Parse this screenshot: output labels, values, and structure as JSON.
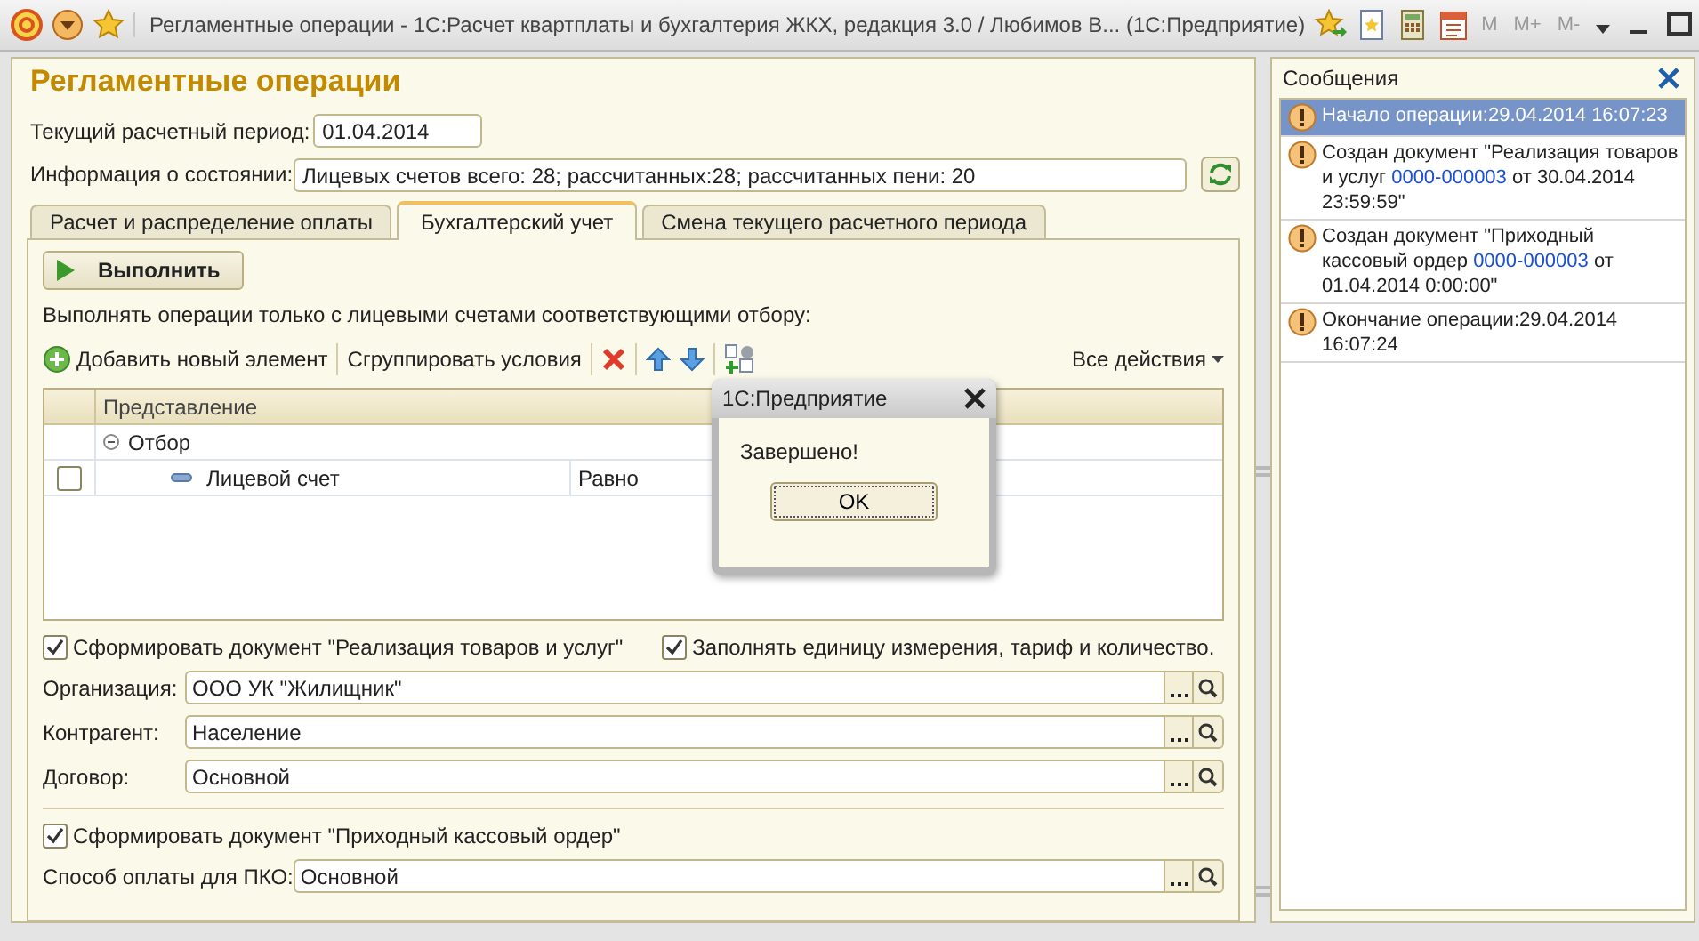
{
  "window": {
    "title": "Регламентные операции - 1С:Расчет квартплаты и бухгалтерия ЖКХ, редакция 3.0 / Любимов В...   (1С:Предприятие)",
    "memory_buttons": [
      {
        "label": "M",
        "disabled": true
      },
      {
        "label": "M+",
        "disabled": true
      },
      {
        "label": "M-",
        "disabled": true
      }
    ]
  },
  "page_title": "Регламентные операции",
  "period": {
    "label": "Текущий расчетный период:",
    "value": "01.04.2014"
  },
  "status_info": {
    "label": "Информация о состоянии:",
    "value": "Лицевых счетов всего: 28; рассчитанных:28; рассчитанных пени: 20"
  },
  "tabs": [
    {
      "label": "Расчет и распределение оплаты",
      "selected": false
    },
    {
      "label": "Бухгалтерский учет",
      "selected": true
    },
    {
      "label": "Смена текущего расчетного периода",
      "selected": false
    }
  ],
  "run_button": "Выполнить",
  "filter_caption": "Выполнять операции только с лицевыми счетами соответствующими отбору:",
  "filter_toolbar": {
    "add": "Добавить новый элемент",
    "group": "Сгруппировать условия",
    "all_actions": "Все действия"
  },
  "table": {
    "columns": [
      {
        "label": "Представление"
      }
    ],
    "rows": [
      {
        "label": "Отбор",
        "expanded": true,
        "children": [
          {
            "label": "Лицевой счет",
            "checked": false,
            "column_2": "Равно"
          }
        ]
      }
    ]
  },
  "options": [
    {
      "label": "Сформировать документ \"Реализация товаров и услуг\"",
      "checked": true
    },
    {
      "label": "Заполнять единицу измерения, тариф и количество.",
      "checked": true
    }
  ],
  "fields": [
    {
      "label": "Организация:",
      "value": "ООО УК \"Жилищник\""
    },
    {
      "label": "Контрагент:",
      "value": "Население"
    },
    {
      "label": "Договор:",
      "value": "Основной"
    }
  ],
  "pko_option": {
    "label": "Сформировать документ \"Приходный кассовый ордер\"",
    "checked": true
  },
  "pko_field": {
    "label": "Способ оплаты для ПКО:",
    "value": "Основной"
  },
  "dialog": {
    "title": "1С:Предприятие",
    "message": "Завершено!",
    "button": "OK"
  },
  "messages": {
    "title": "Сообщения",
    "items": [
      {
        "selected": true,
        "segments": [
          {
            "kind": "plain",
            "text": "Начало операции:29.04.2014 16:07:23"
          }
        ]
      },
      {
        "selected": false,
        "segments": [
          {
            "kind": "plain",
            "text": "Создан документ \"Реализация товаров и услуг "
          },
          {
            "kind": "link",
            "text": "0000-000003"
          },
          {
            "kind": "plain",
            "text": " от 30.04.2014 23:59:59\""
          }
        ]
      },
      {
        "selected": false,
        "segments": [
          {
            "kind": "plain",
            "text": "Создан документ \"Приходный кассовый ордер "
          },
          {
            "kind": "link",
            "text": "0000-000003"
          },
          {
            "kind": "plain",
            "text": " от 01.04.2014 0:00:00\""
          }
        ]
      },
      {
        "selected": false,
        "segments": [
          {
            "kind": "plain",
            "text": "Окончание операции:29.04.2014 16:07:24"
          }
        ]
      }
    ]
  }
}
